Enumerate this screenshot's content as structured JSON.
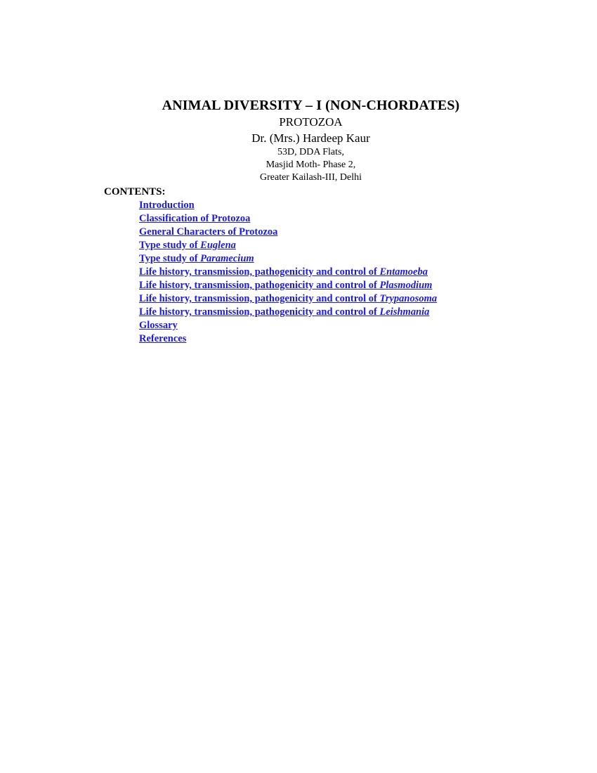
{
  "document": {
    "title": "ANIMAL DIVERSITY – I (NON-CHORDATES)",
    "subtitle": "PROTOZOA",
    "author": "Dr. (Mrs.) Hardeep Kaur",
    "address": [
      "53D, DDA Flats,",
      "Masjid Moth- Phase 2,",
      "Greater Kailash-III, Delhi"
    ]
  },
  "contents": {
    "heading": "CONTENTS:",
    "link_color": "#1a1ae0",
    "items": [
      {
        "text": "Introduction",
        "species": ""
      },
      {
        "text": "Classification of Protozoa",
        "species": ""
      },
      {
        "text": "General Characters of Protozoa",
        "species": ""
      },
      {
        "text": "Type study of ",
        "species": "Euglena"
      },
      {
        "text": "Type study of ",
        "species": "Paramecium"
      },
      {
        "text": "Life history, transmission, pathogenicity and control of  ",
        "species": "Entamoeba"
      },
      {
        "text": "Life history, transmission, pathogenicity and control of  ",
        "species": "Plasmodium"
      },
      {
        "text": "Life history, transmission, pathogenicity and control of  ",
        "species": "Trypanosoma"
      },
      {
        "text": "Life history, transmission, pathogenicity and control of ",
        "species": "Leishmania"
      },
      {
        "text": "Glossary",
        "species": ""
      },
      {
        "text": "References",
        "species": ""
      }
    ]
  }
}
